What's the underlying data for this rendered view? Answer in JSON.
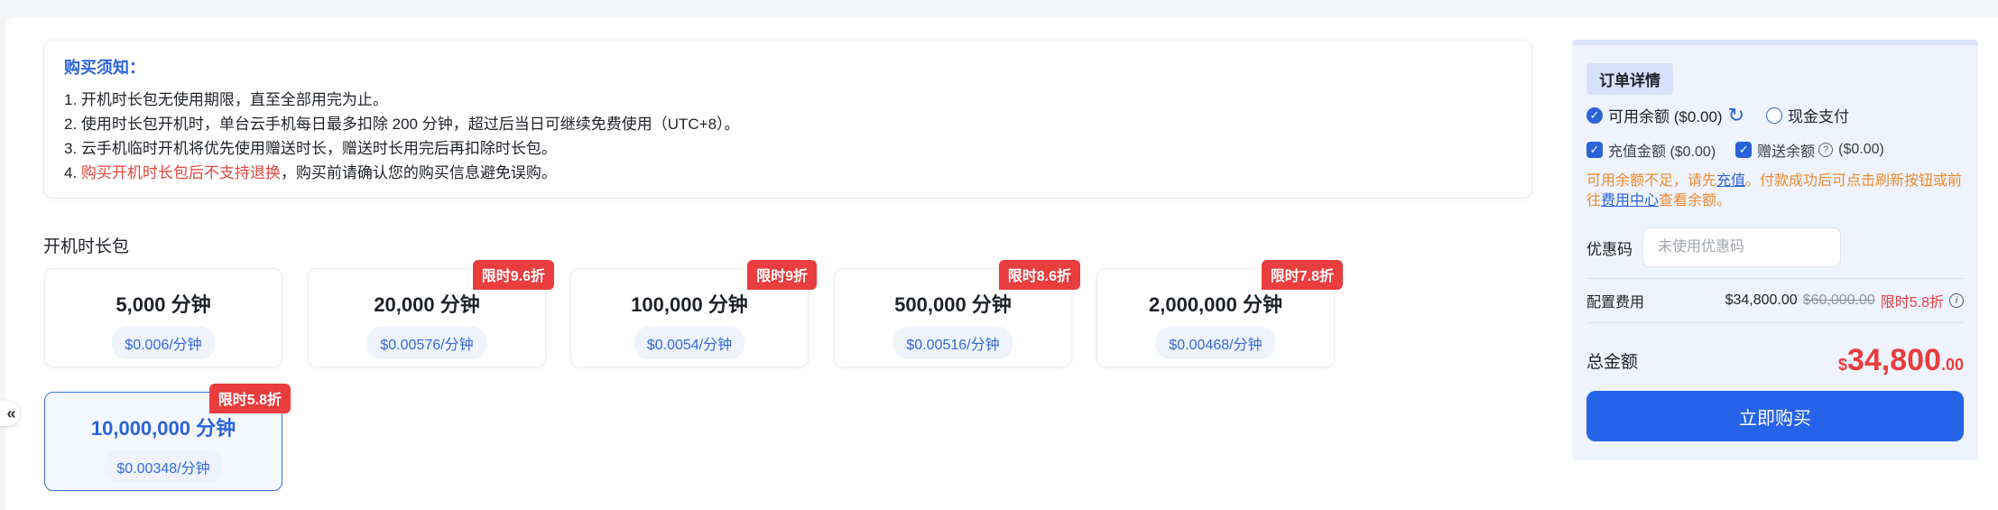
{
  "notice": {
    "title": "购买须知：",
    "line1": "1. 开机时长包无使用期限，直至全部用完为止。",
    "line2": "2. 使用时长包开机时，单台云手机每日最多扣除 200 分钟，超过后当日可继续免费使用（UTC+8）。",
    "line3": "3. 云手机临时开机将优先使用赠送时长，赠送时长用完后再扣除时长包。",
    "line4_prefix": "4. ",
    "line4_warn": "购买开机时长包后不支持退换",
    "line4_suffix": "，购买前请确认您的购买信息避免误购。"
  },
  "section_title": "开机时长包",
  "packages": [
    {
      "name": "5,000 分钟",
      "price": "$0.006/分钟",
      "badge": ""
    },
    {
      "name": "20,000 分钟",
      "price": "$0.00576/分钟",
      "badge": "限时9.6折"
    },
    {
      "name": "100,000 分钟",
      "price": "$0.0054/分钟",
      "badge": "限时9折"
    },
    {
      "name": "500,000 分钟",
      "price": "$0.00516/分钟",
      "badge": "限时8.6折"
    },
    {
      "name": "2,000,000 分钟",
      "price": "$0.00468/分钟",
      "badge": "限时7.8折"
    },
    {
      "name": "10,000,000 分钟",
      "price": "$0.00348/分钟",
      "badge": "限时5.8折",
      "selected": true
    }
  ],
  "order": {
    "title": "订单详情",
    "balance_label": "可用余额 ($0.00)",
    "cash_label": "现金支付",
    "recharge_label": "充值金额 ($0.00)",
    "gift_label": "赠送余额",
    "gift_amount": "($0.00)",
    "warn_prefix": "可用余额不足，请先",
    "warn_link1": "充值",
    "warn_mid": "。付款成功后可点击刷新按钮或前往",
    "warn_link2": "费用中心",
    "warn_suffix": "查看余额。",
    "coupon_label": "优惠码",
    "coupon_placeholder": "未使用优惠码",
    "config_label": "配置费用",
    "config_price": "$34,800.00",
    "config_old": "$60,000.00",
    "config_discount": "限时5.8折",
    "total_label": "总金额",
    "total_currency": "$",
    "total_int": "34,800",
    "total_dec": ".00",
    "buy_label": "立即购买"
  },
  "icons": {
    "collapse": "double-chevron-left-icon",
    "refresh": "refresh-icon",
    "help": "question-circle-icon",
    "info": "info-circle-icon",
    "check": "checkbox-checked-icon"
  },
  "colors": {
    "primary": "#2563e8",
    "badge": "#ea3d3d",
    "warning": "#f08a2c"
  }
}
